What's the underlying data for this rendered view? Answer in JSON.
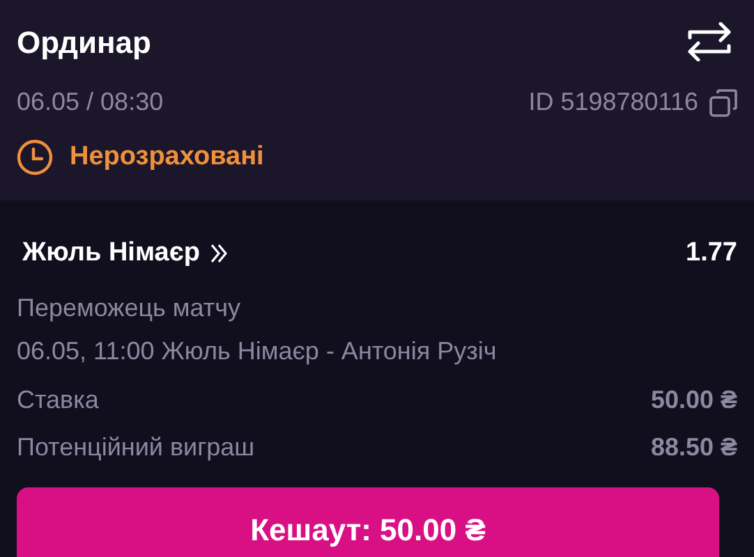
{
  "header": {
    "title": "Ординар",
    "date": "06.05 / 08:30",
    "bet_id": "ID 5198780116",
    "status": "Нерозраховані"
  },
  "selection": {
    "name": "Жюль Німаєр",
    "odds": "1.77",
    "market": "Переможець матчу",
    "event": "06.05, 11:00 Жюль Німаєр - Антонія Рузіч"
  },
  "rows": [
    {
      "label": "Ставка",
      "value": "50.00 ₴"
    },
    {
      "label": "Потенційний виграш",
      "value": "88.50 ₴"
    }
  ],
  "cashout_button": "Кешаут: 50.00 ₴"
}
